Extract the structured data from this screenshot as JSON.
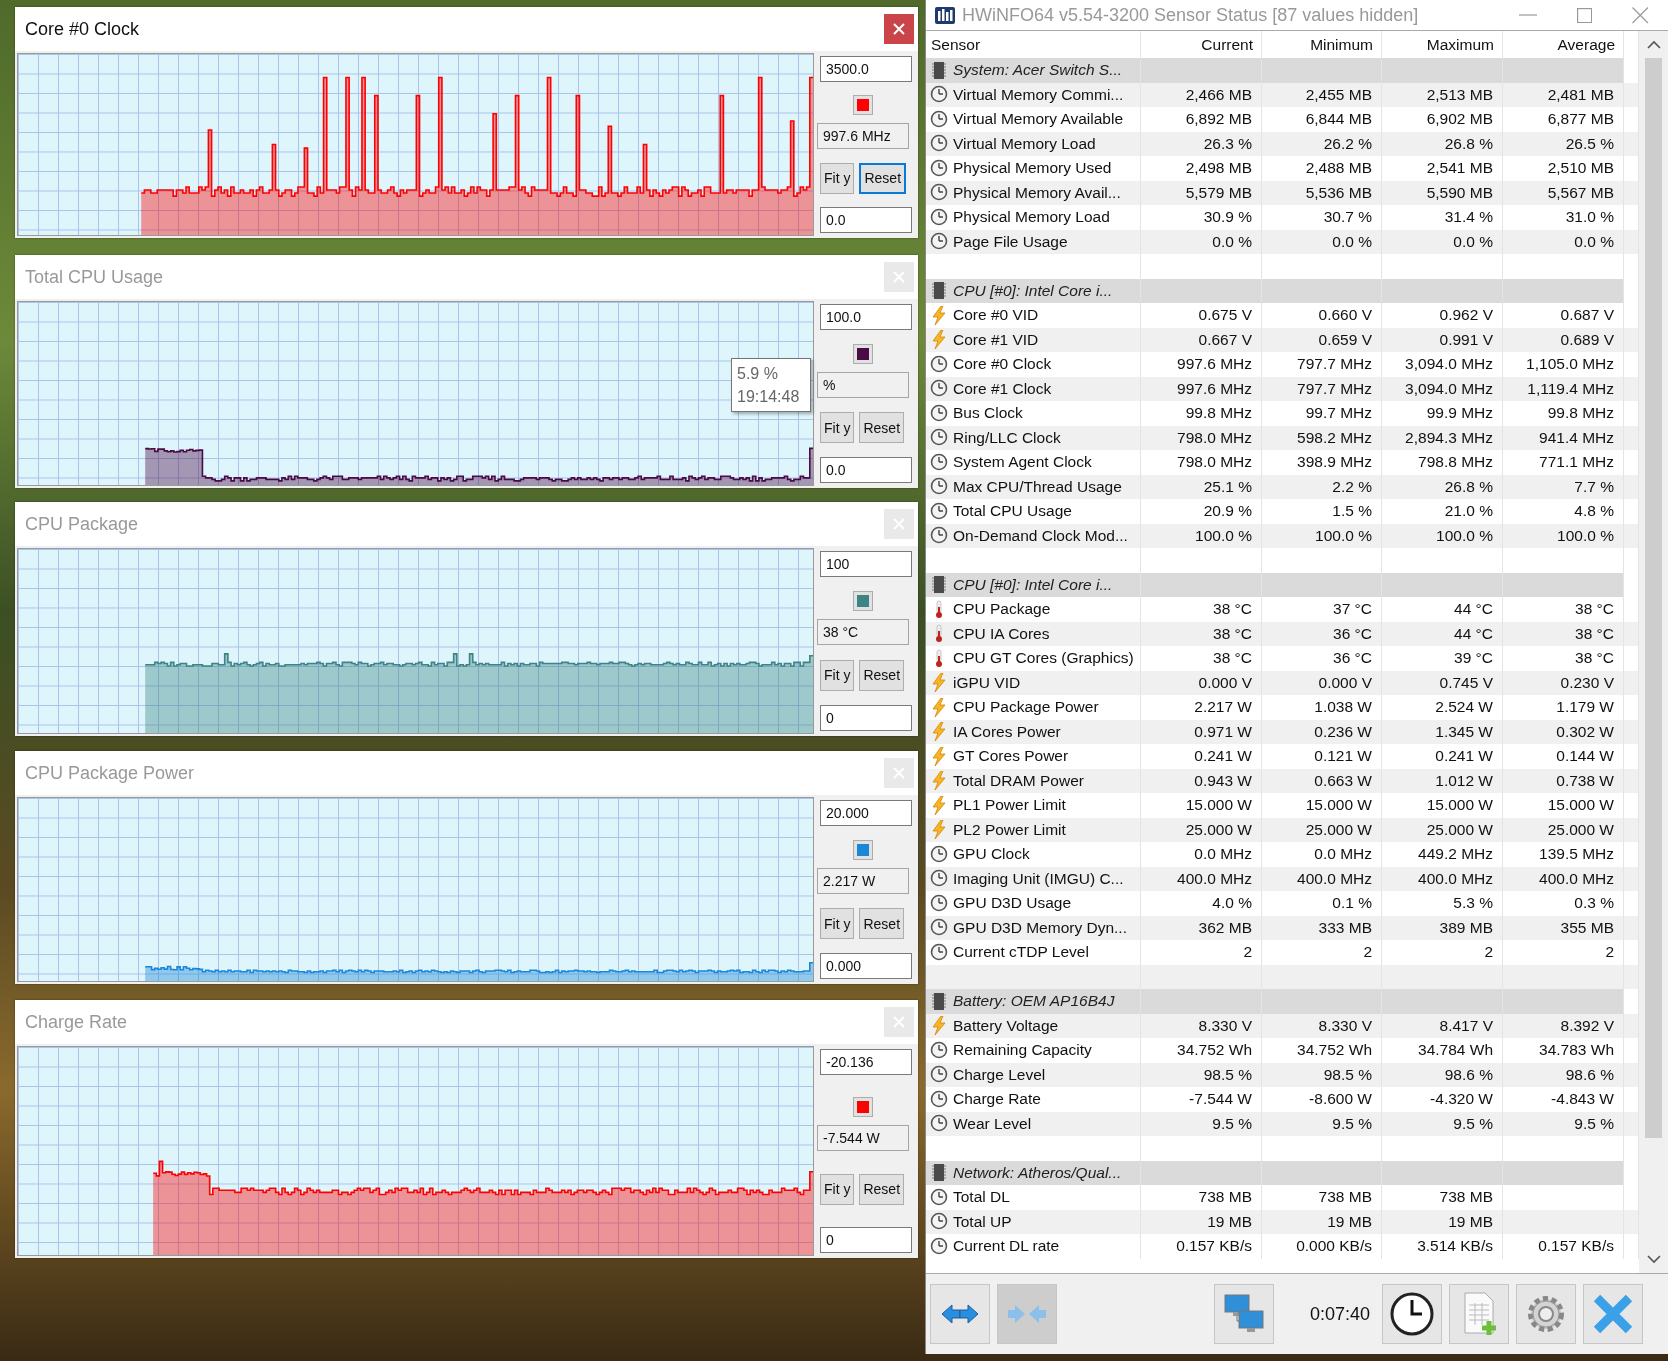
{
  "graph_windows": [
    {
      "title": "Core #0 Clock",
      "active": true,
      "color": "#ff0000",
      "max_value": "3500.0",
      "current_value": "997.6 MHz",
      "min_value": "0.0",
      "buttons": [
        "Fit y",
        "Reset"
      ]
    },
    {
      "title": "Total CPU Usage",
      "active": false,
      "color": "#4b0a45",
      "max_value": "100.0",
      "current_value": "%",
      "min_value": "0.0",
      "buttons": [
        "Fit y",
        "Reset"
      ],
      "tooltip": {
        "value": "5.9 %",
        "time": "19:14:48"
      }
    },
    {
      "title": "CPU Package",
      "active": false,
      "color": "#3d8585",
      "max_value": "100",
      "current_value": "38 °C",
      "min_value": "0",
      "buttons": [
        "Fit y",
        "Reset"
      ]
    },
    {
      "title": "CPU Package Power",
      "active": false,
      "color": "#1a87d8",
      "max_value": "20.000",
      "current_value": "2.217 W",
      "min_value": "0.000",
      "buttons": [
        "Fit y",
        "Reset"
      ]
    },
    {
      "title": "Charge Rate",
      "active": false,
      "color": "#ff0000",
      "max_value": "-20.136",
      "current_value": "-7.544 W",
      "min_value": "0",
      "buttons": [
        "Fit y",
        "Reset"
      ]
    }
  ],
  "sensor_window": {
    "title": "HWiNFO64 v5.54-3200 Sensor Status [87 values hidden]",
    "columns": [
      "Sensor",
      "Current",
      "Minimum",
      "Maximum",
      "Average"
    ],
    "rows": [
      {
        "kind": "group",
        "label": "System: Acer Switch S..."
      },
      {
        "kind": "gauge",
        "label": "Virtual Memory Commi...",
        "current": "2,466 MB",
        "minimum": "2,455 MB",
        "maximum": "2,513 MB",
        "average": "2,481 MB"
      },
      {
        "kind": "gauge",
        "label": "Virtual Memory Available",
        "current": "6,892 MB",
        "minimum": "6,844 MB",
        "maximum": "6,902 MB",
        "average": "6,877 MB"
      },
      {
        "kind": "gauge",
        "label": "Virtual Memory Load",
        "current": "26.3 %",
        "minimum": "26.2 %",
        "maximum": "26.8 %",
        "average": "26.5 %"
      },
      {
        "kind": "gauge",
        "label": "Physical Memory Used",
        "current": "2,498 MB",
        "minimum": "2,488 MB",
        "maximum": "2,541 MB",
        "average": "2,510 MB"
      },
      {
        "kind": "gauge",
        "label": "Physical Memory Avail...",
        "current": "5,579 MB",
        "minimum": "5,536 MB",
        "maximum": "5,590 MB",
        "average": "5,567 MB"
      },
      {
        "kind": "gauge",
        "label": "Physical Memory Load",
        "current": "30.9 %",
        "minimum": "30.7 %",
        "maximum": "31.4 %",
        "average": "31.0 %"
      },
      {
        "kind": "gauge",
        "label": "Page File Usage",
        "current": "0.0 %",
        "minimum": "0.0 %",
        "maximum": "0.0 %",
        "average": "0.0 %"
      },
      {
        "kind": "spacer"
      },
      {
        "kind": "group",
        "label": "CPU [#0]: Intel Core i..."
      },
      {
        "kind": "bolt",
        "label": "Core #0 VID",
        "current": "0.675 V",
        "minimum": "0.660 V",
        "maximum": "0.962 V",
        "average": "0.687 V"
      },
      {
        "kind": "bolt",
        "label": "Core #1 VID",
        "current": "0.667 V",
        "minimum": "0.659 V",
        "maximum": "0.991 V",
        "average": "0.689 V"
      },
      {
        "kind": "gauge",
        "label": "Core #0 Clock",
        "current": "997.6 MHz",
        "minimum": "797.7 MHz",
        "maximum": "3,094.0 MHz",
        "average": "1,105.0 MHz"
      },
      {
        "kind": "gauge",
        "label": "Core #1 Clock",
        "current": "997.6 MHz",
        "minimum": "797.7 MHz",
        "maximum": "3,094.0 MHz",
        "average": "1,119.4 MHz"
      },
      {
        "kind": "gauge",
        "label": "Bus Clock",
        "current": "99.8 MHz",
        "minimum": "99.7 MHz",
        "maximum": "99.9 MHz",
        "average": "99.8 MHz"
      },
      {
        "kind": "gauge",
        "label": "Ring/LLC Clock",
        "current": "798.0 MHz",
        "minimum": "598.2 MHz",
        "maximum": "2,894.3 MHz",
        "average": "941.4 MHz"
      },
      {
        "kind": "gauge",
        "label": "System Agent Clock",
        "current": "798.0 MHz",
        "minimum": "398.9 MHz",
        "maximum": "798.8 MHz",
        "average": "771.1 MHz"
      },
      {
        "kind": "gauge",
        "label": "Max CPU/Thread Usage",
        "current": "25.1 %",
        "minimum": "2.2 %",
        "maximum": "26.8 %",
        "average": "7.7 %"
      },
      {
        "kind": "gauge",
        "label": "Total CPU Usage",
        "current": "20.9 %",
        "minimum": "1.5 %",
        "maximum": "21.0 %",
        "average": "4.8 %"
      },
      {
        "kind": "gauge",
        "label": "On-Demand Clock Mod...",
        "current": "100.0 %",
        "minimum": "100.0 %",
        "maximum": "100.0 %",
        "average": "100.0 %"
      },
      {
        "kind": "spacer"
      },
      {
        "kind": "group",
        "label": "CPU [#0]: Intel Core i..."
      },
      {
        "kind": "thermometer",
        "label": "CPU Package",
        "current": "38 °C",
        "minimum": "37 °C",
        "maximum": "44 °C",
        "average": "38 °C"
      },
      {
        "kind": "thermometer",
        "label": "CPU IA Cores",
        "current": "38 °C",
        "minimum": "36 °C",
        "maximum": "44 °C",
        "average": "38 °C"
      },
      {
        "kind": "thermometer",
        "label": "CPU GT Cores (Graphics)",
        "current": "38 °C",
        "minimum": "36 °C",
        "maximum": "39 °C",
        "average": "38 °C"
      },
      {
        "kind": "bolt",
        "label": "iGPU VID",
        "current": "0.000 V",
        "minimum": "0.000 V",
        "maximum": "0.745 V",
        "average": "0.230 V"
      },
      {
        "kind": "bolt",
        "label": "CPU Package Power",
        "current": "2.217 W",
        "minimum": "1.038 W",
        "maximum": "2.524 W",
        "average": "1.179 W"
      },
      {
        "kind": "bolt",
        "label": "IA Cores Power",
        "current": "0.971 W",
        "minimum": "0.236 W",
        "maximum": "1.345 W",
        "average": "0.302 W"
      },
      {
        "kind": "bolt",
        "label": "GT Cores Power",
        "current": "0.241 W",
        "minimum": "0.121 W",
        "maximum": "0.241 W",
        "average": "0.144 W"
      },
      {
        "kind": "bolt",
        "label": "Total DRAM Power",
        "current": "0.943 W",
        "minimum": "0.663 W",
        "maximum": "1.012 W",
        "average": "0.738 W"
      },
      {
        "kind": "bolt",
        "label": "PL1 Power Limit",
        "current": "15.000 W",
        "minimum": "15.000 W",
        "maximum": "15.000 W",
        "average": "15.000 W"
      },
      {
        "kind": "bolt",
        "label": "PL2 Power Limit",
        "current": "25.000 W",
        "minimum": "25.000 W",
        "maximum": "25.000 W",
        "average": "25.000 W"
      },
      {
        "kind": "gauge",
        "label": "GPU Clock",
        "current": "0.0 MHz",
        "minimum": "0.0 MHz",
        "maximum": "449.2 MHz",
        "average": "139.5 MHz"
      },
      {
        "kind": "gauge",
        "label": "Imaging Unit (IMGU) C...",
        "current": "400.0 MHz",
        "minimum": "400.0 MHz",
        "maximum": "400.0 MHz",
        "average": "400.0 MHz"
      },
      {
        "kind": "gauge",
        "label": "GPU D3D Usage",
        "current": "4.0 %",
        "minimum": "0.1 %",
        "maximum": "5.3 %",
        "average": "0.3 %"
      },
      {
        "kind": "gauge",
        "label": "GPU D3D Memory Dyn...",
        "current": "362 MB",
        "minimum": "333 MB",
        "maximum": "389 MB",
        "average": "355 MB"
      },
      {
        "kind": "gauge",
        "label": "Current cTDP Level",
        "current": "2",
        "minimum": "2",
        "maximum": "2",
        "average": "2"
      },
      {
        "kind": "spacer"
      },
      {
        "kind": "group",
        "label": "Battery: OEM AP16B4J"
      },
      {
        "kind": "bolt",
        "label": "Battery Voltage",
        "current": "8.330 V",
        "minimum": "8.330 V",
        "maximum": "8.417 V",
        "average": "8.392 V"
      },
      {
        "kind": "gauge",
        "label": "Remaining Capacity",
        "current": "34.752 Wh",
        "minimum": "34.752 Wh",
        "maximum": "34.784 Wh",
        "average": "34.783 Wh"
      },
      {
        "kind": "gauge",
        "label": "Charge Level",
        "current": "98.5 %",
        "minimum": "98.5 %",
        "maximum": "98.6 %",
        "average": "98.6 %"
      },
      {
        "kind": "gauge",
        "label": "Charge Rate",
        "current": "-7.544 W",
        "minimum": "-8.600 W",
        "maximum": "-4.320 W",
        "average": "-4.843 W"
      },
      {
        "kind": "gauge",
        "label": "Wear Level",
        "current": "9.5 %",
        "minimum": "9.5 %",
        "maximum": "9.5 %",
        "average": "9.5 %"
      },
      {
        "kind": "spacer"
      },
      {
        "kind": "group",
        "label": "Network: Atheros/Qual..."
      },
      {
        "kind": "gauge",
        "label": "Total DL",
        "current": "738 MB",
        "minimum": "738 MB",
        "maximum": "738 MB"
      },
      {
        "kind": "gauge",
        "label": "Total UP",
        "current": "19 MB",
        "minimum": "19 MB",
        "maximum": "19 MB"
      },
      {
        "kind": "gauge",
        "label": "Current DL rate",
        "current": "0.157 KB/s",
        "minimum": "0.000 KB/s",
        "maximum": "3.514 KB/s",
        "average": "0.157 KB/s"
      }
    ],
    "toolbar": {
      "left_buttons": [
        {
          "kind": "expand",
          "pressed": false
        },
        {
          "kind": "collapse",
          "pressed": true
        },
        {
          "kind": "network",
          "pressed": false
        }
      ],
      "elapsed": "0:07:40",
      "right_buttons": [
        {
          "kind": "clock"
        },
        {
          "kind": "report"
        },
        {
          "kind": "settings"
        },
        {
          "kind": "close"
        }
      ]
    }
  }
}
